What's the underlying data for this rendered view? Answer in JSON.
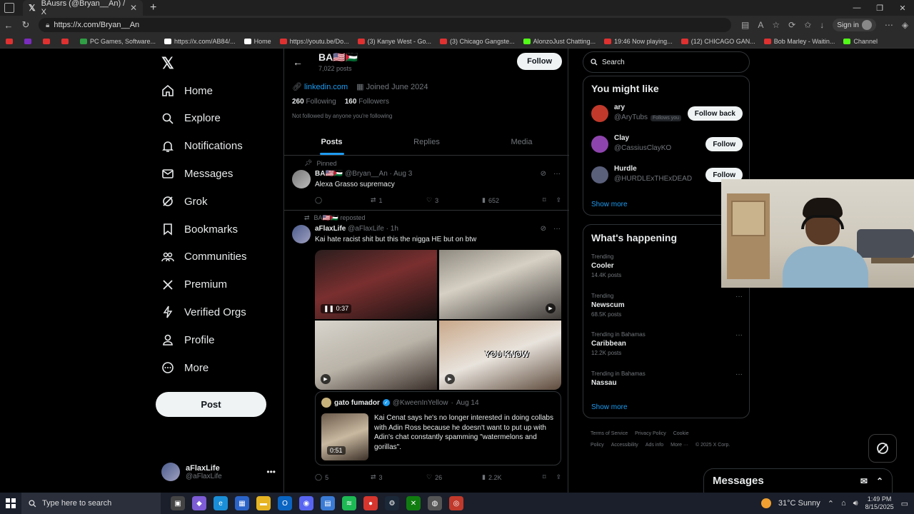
{
  "browser": {
    "tab_title": "BAusrs (@Bryan__An) / X",
    "url": "https://x.com/Bryan__An",
    "signin_label": "Sign in",
    "bookmarks": [
      {
        "label": "",
        "color": "#e03131"
      },
      {
        "label": "",
        "color": "#7b2cbf"
      },
      {
        "label": "",
        "color": "#e03131"
      },
      {
        "label": "",
        "color": "#e03131"
      },
      {
        "label": "PC Games, Software...",
        "color": "#2f9e44"
      },
      {
        "label": "https://x.com/AB84/...",
        "color": "#ffffff"
      },
      {
        "label": "Home",
        "color": "#ffffff"
      },
      {
        "label": "https://youtu.be/Do...",
        "color": "#e03131"
      },
      {
        "label": "(3) Kanye West - Go...",
        "color": "#e03131"
      },
      {
        "label": "(3) Chicago Gangste...",
        "color": "#e03131"
      },
      {
        "label": "AlonzoJust Chatting...",
        "color": "#53fc18"
      },
      {
        "label": "19:46 Now playing...",
        "color": "#e03131"
      },
      {
        "label": "(12) CHICAGO GAN...",
        "color": "#e03131"
      },
      {
        "label": "Bob Marley - Waitin...",
        "color": "#e03131"
      },
      {
        "label": "Channel",
        "color": "#53fc18"
      }
    ]
  },
  "nav": {
    "items": [
      {
        "label": "Home",
        "icon": "home-icon"
      },
      {
        "label": "Explore",
        "icon": "search-icon"
      },
      {
        "label": "Notifications",
        "icon": "bell-icon"
      },
      {
        "label": "Messages",
        "icon": "mail-icon"
      },
      {
        "label": "Grok",
        "icon": "grok-icon"
      },
      {
        "label": "Bookmarks",
        "icon": "bookmark-icon"
      },
      {
        "label": "Communities",
        "icon": "people-icon"
      },
      {
        "label": "Premium",
        "icon": "x-icon"
      },
      {
        "label": "Verified Orgs",
        "icon": "lightning-icon"
      },
      {
        "label": "Profile",
        "icon": "person-icon"
      },
      {
        "label": "More",
        "icon": "more-icon"
      }
    ],
    "post_label": "Post",
    "account_name": "aFlaxLife",
    "account_handle": "@aFlaxLife"
  },
  "profile": {
    "name": "BA🇺🇸🇵🇸",
    "posts_count": "7,022 posts",
    "follow_label": "Follow",
    "link": "linkedin.com",
    "joined": "Joined June 2024",
    "following_count": "260",
    "following_label": "Following",
    "followers_count": "160",
    "followers_label": "Followers",
    "not_followed": "Not followed by anyone you're following",
    "tabs": [
      "Posts",
      "Replies",
      "Media"
    ]
  },
  "tweets": {
    "pinned": {
      "context": "Pinned",
      "name": "BA🇺🇸🇵🇸",
      "handle": "@Bryan__An",
      "date": "Aug 3",
      "text": "Alexa Grasso supremacy",
      "replies": "",
      "reposts": "1",
      "likes": "3",
      "views": "652"
    },
    "repost": {
      "context": "BA🇺🇸🇵🇸 reposted",
      "name": "aFlaxLife",
      "handle": "@aFlaxLife",
      "date": "1h",
      "text": "Kai hate racist shit but this the nigga HE but on btw",
      "video_duration": "0:37",
      "overlay_text": "YOU KNOW",
      "replies": "5",
      "reposts": "3",
      "likes": "26",
      "views": "2.2K",
      "quote": {
        "name": "gato fumador",
        "handle": "@KweenInYellow",
        "date": "Aug 14",
        "text": "Kai Cenat says he's no longer interested in doing collabs with Adin Ross because he doesn't want to put up with Adin's chat constantly spamming \"watermelons and gorillas\".",
        "duration": "0:51"
      }
    }
  },
  "right": {
    "search_placeholder": "Search",
    "you_might_like_title": "You might like",
    "suggestions": [
      {
        "name": "ary",
        "handle": "@AryTubs",
        "badge": "Follows you",
        "button": "Follow back",
        "color": "#c0392b"
      },
      {
        "name": "Clay",
        "handle": "@CassiusClayKO",
        "badge": "",
        "button": "Follow",
        "color": "#8e44ad"
      },
      {
        "name": "Hurdle",
        "handle": "@HURDLExTHExDEAD",
        "badge": "",
        "button": "Follow",
        "color": "#5a5f7a"
      }
    ],
    "show_more": "Show more",
    "happening_title": "What's happening",
    "trends": [
      {
        "context": "Trending",
        "topic": "Cooler",
        "posts": "14.4K posts"
      },
      {
        "context": "Trending",
        "topic": "Newscum",
        "posts": "68.5K posts"
      },
      {
        "context": "Trending in Bahamas",
        "topic": "Caribbean",
        "posts": "12.2K posts"
      },
      {
        "context": "Trending in Bahamas",
        "topic": "Nassau",
        "posts": ""
      }
    ],
    "footer": [
      "Terms of Service",
      "Privacy Policy",
      "Cookie Policy",
      "Accessibility",
      "Ads info",
      "More ···",
      "© 2025 X Corp."
    ]
  },
  "messages_drawer": {
    "label": "Messages"
  },
  "taskbar": {
    "search_placeholder": "Type here to search",
    "weather": "31°C  Sunny",
    "time": "1:49 PM",
    "date": "8/15/2025"
  }
}
